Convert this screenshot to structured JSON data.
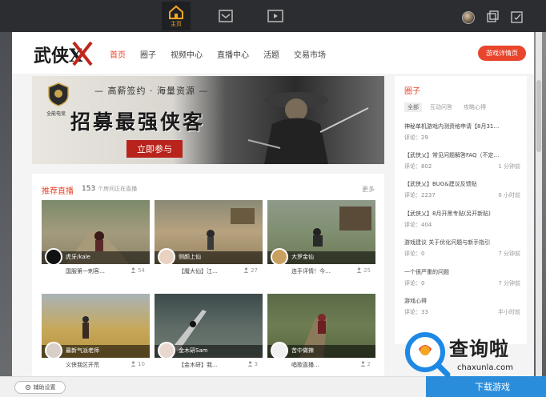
{
  "topbar": {
    "home_label": "主页"
  },
  "header": {
    "logo_text": "武侠X",
    "nav": [
      "首页",
      "圈子",
      "视频中心",
      "直播中心",
      "活题",
      "交易市场"
    ],
    "cta_label": "游戏详情页"
  },
  "banner": {
    "badge_text": "全能电竞",
    "tagline": "— 高薪签约 · 海量资源 —",
    "headline": "招募最强侠客",
    "join_label": "立即参与"
  },
  "live": {
    "title": "推荐直播",
    "count": "153",
    "count_suffix": "个房间正在直播",
    "more_label": "更多",
    "cards": [
      {
        "host": "虎牙/kale",
        "desc": "国服第一刺客…",
        "viewers": "54"
      },
      {
        "host": "侧颜上仙",
        "desc": "【魔大仙】江…",
        "viewers": "27"
      },
      {
        "host": "大罗金仙",
        "desc": "连手评情！今…",
        "viewers": "25"
      },
      {
        "host": "最新气派老师",
        "desc": "义侠我区开荒",
        "viewers": "10"
      },
      {
        "host": "金木研Sam",
        "desc": "【金木研】我…",
        "viewers": "3"
      },
      {
        "host": "苦中做辣",
        "desc": "唱歌直播…",
        "viewers": "2"
      }
    ]
  },
  "sidebar": {
    "title": "圈子",
    "tabs": [
      "全部",
      "互动问答",
      "攻略心得"
    ],
    "posts": [
      {
        "title": "神秘单机游戏内测资格申请【8月31…",
        "comments": "评论：29",
        "time": ""
      },
      {
        "title": "【武侠乂】常见问题解答FAQ（不定…",
        "comments": "评论：802",
        "time": "1 分钟前"
      },
      {
        "title": "【武侠乂】BUG&建议反馈贴",
        "comments": "评论：2237",
        "time": "6 小时前"
      },
      {
        "title": "【武侠乂】8月开黑专贴(另开新贴)",
        "comments": "评论：404",
        "time": ""
      },
      {
        "title": "游戏建议 关于优化问题与新手指引",
        "comments": "评论：0",
        "time": "7 分钟前"
      },
      {
        "title": "一个很严重的问题",
        "comments": "评论：0",
        "time": "7 分钟前"
      },
      {
        "title": "游戏心得",
        "comments": "评论：33",
        "time": "半小时前"
      }
    ]
  },
  "bottom": {
    "assist_label": "辅助设置",
    "download_label": "下载游戏"
  },
  "watermark": {
    "text": "查询啦",
    "url": "chaxunla.com"
  }
}
